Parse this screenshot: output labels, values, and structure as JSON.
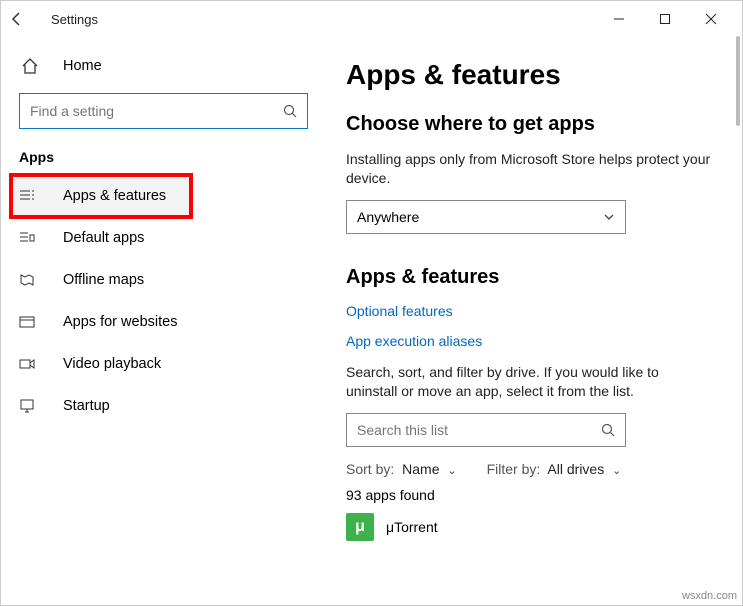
{
  "titlebar": {
    "title": "Settings"
  },
  "sidebar": {
    "home": "Home",
    "search_placeholder": "Find a setting",
    "group": "Apps",
    "items": [
      {
        "label": "Apps & features"
      },
      {
        "label": "Default apps"
      },
      {
        "label": "Offline maps"
      },
      {
        "label": "Apps for websites"
      },
      {
        "label": "Video playback"
      },
      {
        "label": "Startup"
      }
    ]
  },
  "main": {
    "h1": "Apps & features",
    "choose_heading": "Choose where to get apps",
    "choose_body": "Installing apps only from Microsoft Store helps protect your device.",
    "source_value": "Anywhere",
    "section_heading": "Apps & features",
    "link_optional": "Optional features",
    "link_aliases": "App execution aliases",
    "filter_body": "Search, sort, and filter by drive. If you would like to uninstall or move an app, select it from the list.",
    "filter_placeholder": "Search this list",
    "sort_label": "Sort by:",
    "sort_value": "Name",
    "filter_label": "Filter by:",
    "filter_value": "All drives",
    "count": "93 apps found",
    "first_app": "μTorrent"
  },
  "watermark": "wsxdn.com"
}
